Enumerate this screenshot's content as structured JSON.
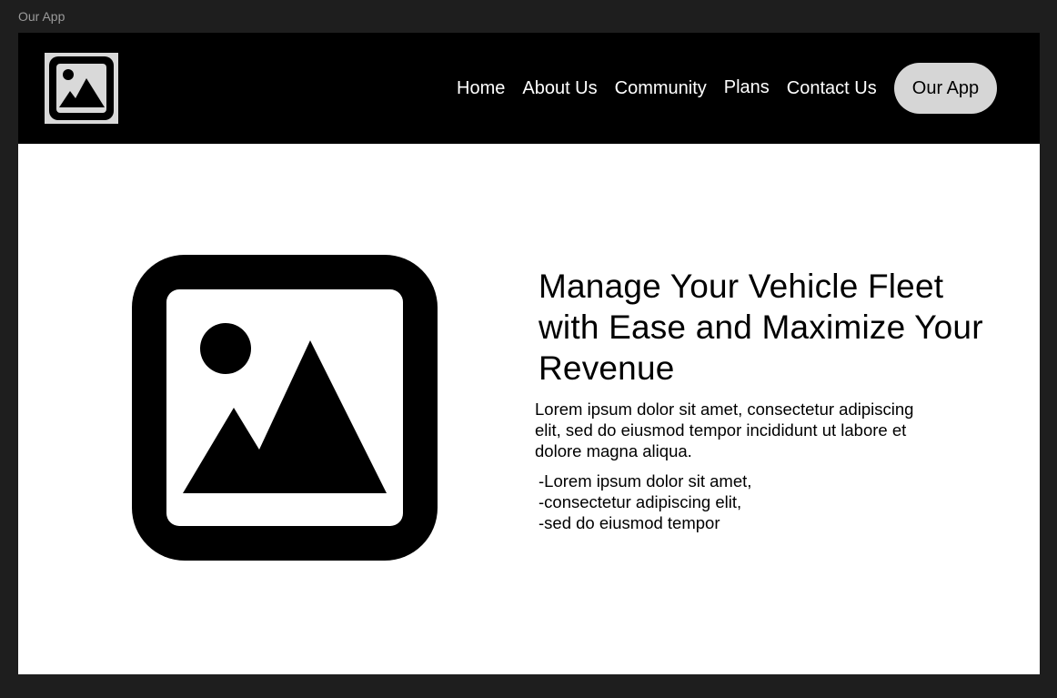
{
  "frame": {
    "label": "Our App"
  },
  "nav": {
    "logo_icon": "image-placeholder-icon",
    "links": [
      "Home",
      "About Us",
      "Community",
      "Plans",
      "Contact Us"
    ],
    "cta_label": "Our App"
  },
  "hero": {
    "image_icon": "image-placeholder-icon",
    "headline": "Manage Your Vehicle Fleet with Ease and Maximize Your Revenue",
    "body": "Lorem ipsum dolor sit amet, consectetur adipiscing elit, sed do eiusmod tempor incididunt ut labore et dolore magna aliqua.",
    "bullets": [
      "-Lorem ipsum dolor sit amet,",
      "-consectetur adipiscing elit,",
      "-sed do eiusmod tempor"
    ]
  },
  "colors": {
    "background": "#1e1e1e",
    "navbar": "#000000",
    "page": "#ffffff",
    "cta": "#d6d6d6",
    "logo_bg": "#d9d9d9"
  }
}
